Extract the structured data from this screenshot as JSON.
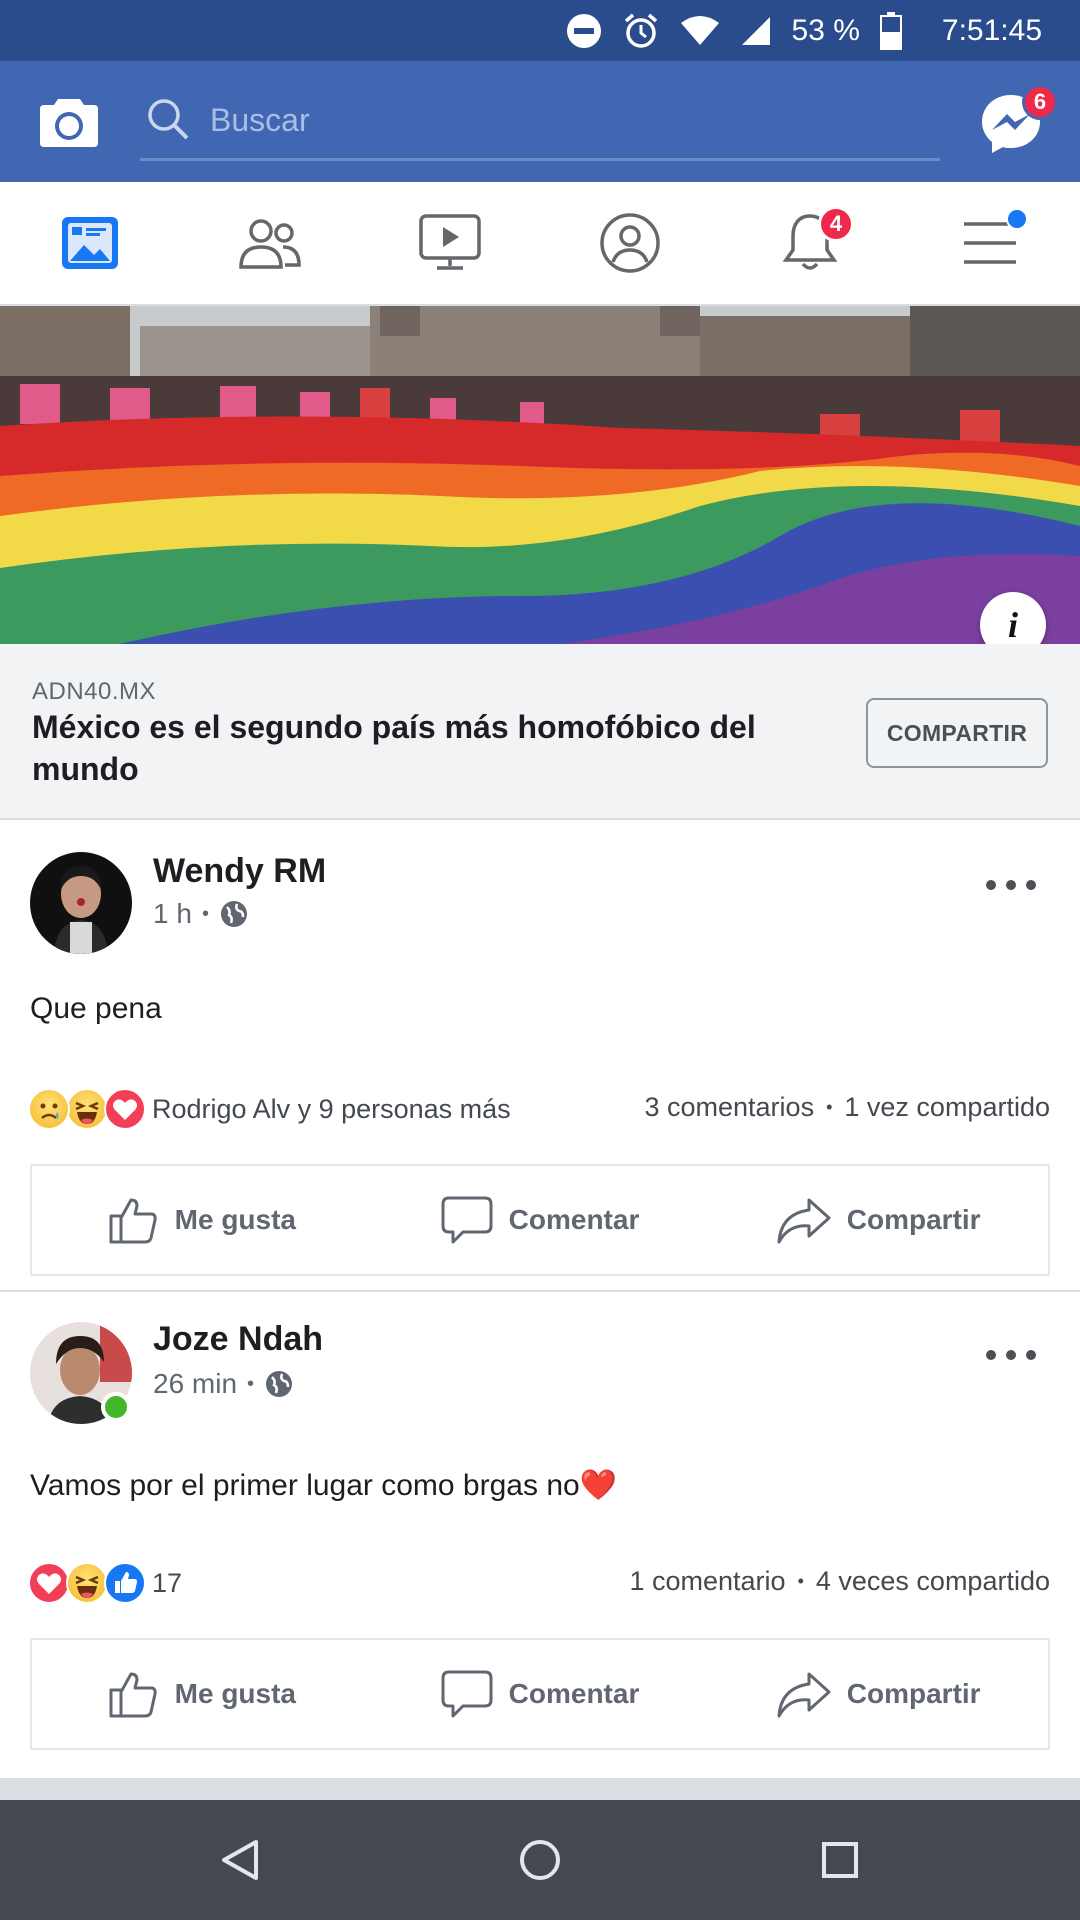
{
  "status_bar": {
    "battery_percent": "53 %",
    "time": "7:51:45",
    "icons": [
      "do-not-disturb-icon",
      "alarm-icon",
      "wifi-icon",
      "cell-signal-icon",
      "battery-icon"
    ]
  },
  "top_bar": {
    "search_placeholder": "Buscar",
    "messenger_badge": "6",
    "colors": {
      "bar": "#4267b2",
      "status": "#2b4c8c",
      "badge": "#f02849"
    }
  },
  "nav_tabs": {
    "items": [
      "news-feed",
      "friends",
      "watch",
      "profile",
      "notifications",
      "menu"
    ],
    "notifications_badge": "4"
  },
  "shared_link": {
    "source": "ADN40.MX",
    "title": "México es el segundo país más homofóbico del mundo",
    "share_label": "COMPARTIR",
    "info_glyph": "i"
  },
  "posts": [
    {
      "author": "Wendy RM",
      "time": "1 h",
      "text": "Que pena",
      "reactions_text": "Rodrigo Alv y 9 personas más",
      "reaction_types": [
        "sad",
        "haha",
        "love"
      ],
      "comments": "3 comentarios",
      "shares": "1 vez compartido",
      "online": false
    },
    {
      "author": "Joze Ndah",
      "time": "26 min",
      "text": "Vamos por el primer lugar como brgas no❤️",
      "reactions_text": "17",
      "reaction_types": [
        "love",
        "haha",
        "like"
      ],
      "comments": "1 comentario",
      "shares": "4 veces compartido",
      "online": true
    }
  ],
  "actions": {
    "like": "Me gusta",
    "comment": "Comentar",
    "share": "Compartir"
  },
  "sep": "•"
}
